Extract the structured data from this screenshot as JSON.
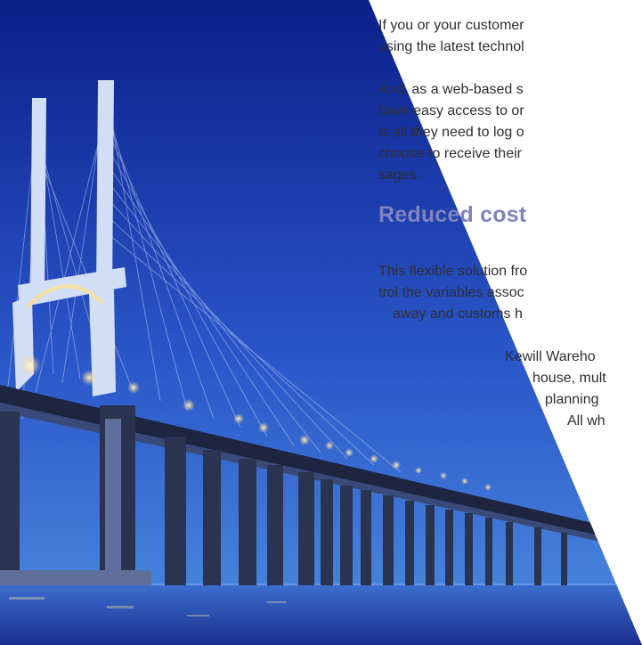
{
  "paragraph1": {
    "lines": [
      "If you or your customer",
      "using the latest technol"
    ]
  },
  "paragraph2": {
    "lines": [
      "And, as a web-based s",
      "have easy access to or",
      "is all they need to log o",
      "choose to receive their",
      "sages."
    ]
  },
  "heading": "Reduced cost",
  "paragraph3": {
    "lines": [
      "This flexible solution fro",
      "trol the variables assoc",
      "away and customs h"
    ]
  },
  "paragraph4": {
    "lines": [
      "Kewill Wareho",
      "house, mult",
      "planning",
      "All wh"
    ]
  },
  "colors": {
    "heading": "#7f83bf",
    "body_text": "#2f2f33",
    "sky_top": "#0b1f8a",
    "sky_bottom": "#4d8de0",
    "bridge": "#2a3350"
  },
  "photo": {
    "subject": "bridge-photo"
  }
}
